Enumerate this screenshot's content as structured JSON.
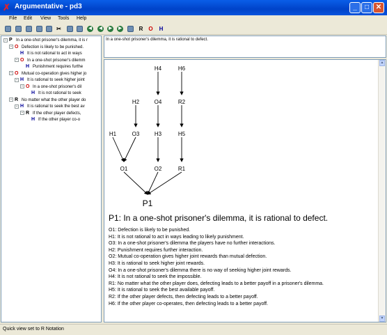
{
  "window": {
    "title": "Argumentative - pd3",
    "app_icon": "scale-icon"
  },
  "menu": [
    "File",
    "Edit",
    "View",
    "Tools",
    "Help"
  ],
  "toolbar": {
    "letters": [
      "R",
      "O",
      "H"
    ],
    "colors": {
      "R": "#000000",
      "O": "#cc0000",
      "H": "#000099"
    }
  },
  "tree": [
    {
      "indent": 0,
      "expander": "-",
      "letter": "P",
      "color": "#000000",
      "text": "In a one-shot prisoner's dilemma, it is r"
    },
    {
      "indent": 1,
      "expander": "-",
      "letter": "O",
      "color": "#cc0000",
      "text": "Defection is likely to be punished."
    },
    {
      "indent": 2,
      "expander": "",
      "letter": "H",
      "color": "#000099",
      "text": "It is not rational to act in ways"
    },
    {
      "indent": 2,
      "expander": "-",
      "letter": "O",
      "color": "#cc0000",
      "text": "In a one-shot prisoner's dilemm"
    },
    {
      "indent": 3,
      "expander": "",
      "letter": "H",
      "color": "#000099",
      "text": "Punishment requires furthe"
    },
    {
      "indent": 1,
      "expander": "-",
      "letter": "O",
      "color": "#cc0000",
      "text": "Mutual co-operation gives higher jo"
    },
    {
      "indent": 2,
      "expander": "-",
      "letter": "H",
      "color": "#000099",
      "text": "It is rational to seek higher joint"
    },
    {
      "indent": 3,
      "expander": "-",
      "letter": "O",
      "color": "#cc0000",
      "text": "In a one-shot prisoner's dil"
    },
    {
      "indent": 4,
      "expander": "",
      "letter": "H",
      "color": "#000099",
      "text": "It is not rational to seek"
    },
    {
      "indent": 1,
      "expander": "-",
      "letter": "R",
      "color": "#000000",
      "text": "No matter what the other player do"
    },
    {
      "indent": 2,
      "expander": "-",
      "letter": "H",
      "color": "#000099",
      "text": "It is rational to seek the best av"
    },
    {
      "indent": 3,
      "expander": "-",
      "letter": "R",
      "color": "#000000",
      "text": "If the other player defects,"
    },
    {
      "indent": 4,
      "expander": "",
      "letter": "H",
      "color": "#000099",
      "text": "If the other player co-o"
    }
  ],
  "editor_text": "In a one-shot prisoner's dilemma, it is rational to defect.",
  "diagram": {
    "nodes": [
      "H4",
      "H6",
      "H2",
      "O4",
      "R2",
      "H1",
      "O3",
      "H3",
      "H5",
      "O1",
      "O2",
      "R1",
      "P1"
    ],
    "edges": [
      [
        "H4",
        "O4"
      ],
      [
        "H6",
        "R2"
      ],
      [
        "H2",
        "O3"
      ],
      [
        "O4",
        "H3"
      ],
      [
        "R2",
        "H5"
      ],
      [
        "H1",
        "O1"
      ],
      [
        "O3",
        "O1"
      ],
      [
        "H3",
        "O2"
      ],
      [
        "H5",
        "R1"
      ],
      [
        "O1",
        "P1"
      ],
      [
        "O2",
        "P1"
      ],
      [
        "R1",
        "P1"
      ]
    ]
  },
  "heading": "P1: In a one-shot prisoner's dilemma, it is rational to defect.",
  "legend": [
    "O1: Defection is likely to be punished.",
    "H1: It is not rational to act in ways leading to likely punishment.",
    "O3: In a one-shot prisoner's dilemma the players have no further interactions.",
    "H2: Punishment requires further interaction.",
    "O2: Mutual co-operation gives higher joint rewards than mutual defection.",
    "H3: It is rational to seek higher joint rewards.",
    "O4: In a one-shot prisoner's dilemma there is no way of seeking higher joint rewards.",
    "H4: It is not rational to seek the impossible.",
    "R1: No matter what the other player does, defecting leads to a better payoff in a prisoner's dilemma.",
    "H5: It is rational to seek the best available payoff.",
    "R2: If the other player defects, then defecting leads to a better payoff.",
    "H6: If the other player co-operates, then defecting leads to a better payoff."
  ],
  "status": "Quick view set to R Notation"
}
